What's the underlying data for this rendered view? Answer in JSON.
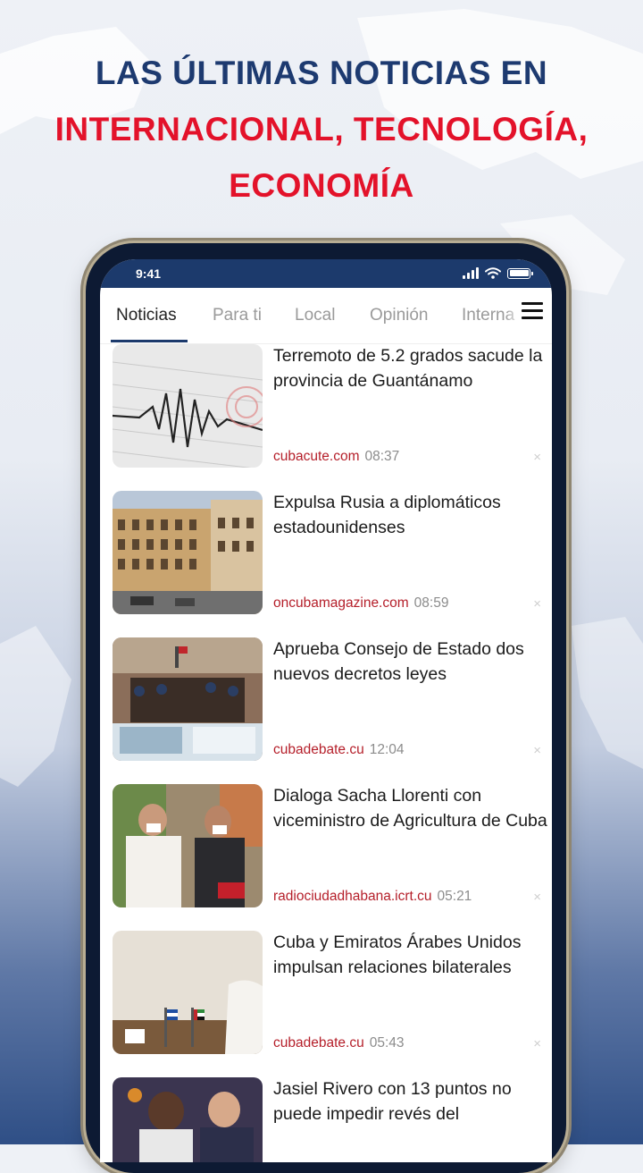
{
  "headline": {
    "line1": "LAS ÚLTIMAS NOTICIAS EN",
    "line2": "INTERNACIONAL, TECNOLOGÍA,",
    "line3": "ECONOMÍA"
  },
  "status_bar": {
    "time": "9:41",
    "icons": [
      "signal-icon",
      "wifi-icon",
      "battery-icon"
    ]
  },
  "tabs": [
    {
      "label": "Noticias",
      "active": true
    },
    {
      "label": "Para ti",
      "active": false
    },
    {
      "label": "Local",
      "active": false
    },
    {
      "label": "Opinión",
      "active": false
    },
    {
      "label": "Interna",
      "active": false
    }
  ],
  "menu_icon": "hamburger-menu-icon",
  "feed": [
    {
      "title": "Terremoto de 5.2 grados sacude la provincia de Guantánamo",
      "source": "cubacute.com",
      "time": "08:37",
      "thumb": "seismograph"
    },
    {
      "title": "Expulsa Rusia a diplomáticos estadounidenses",
      "source": "oncubamagazine.com",
      "time": "08:59",
      "thumb": "embassy-building"
    },
    {
      "title": "Aprueba Consejo de Estado dos nuevos decretos leyes",
      "source": "cubadebate.cu",
      "time": "12:04",
      "thumb": "council-meeting"
    },
    {
      "title": "Dialoga Sacha Llorenti con viceministro de Agricultura de Cuba",
      "source": "radiociudadhabana.icrt.cu",
      "time": "05:21",
      "thumb": "two-men-masks"
    },
    {
      "title": "Cuba y Emiratos Árabes Unidos impulsan relaciones bilaterales",
      "source": "cubadebate.cu",
      "time": "05:43",
      "thumb": "flags-table"
    },
    {
      "title": "Jasiel Rivero con 13 puntos no puede impedir revés del",
      "source": "",
      "time": "",
      "thumb": "basketball-players"
    }
  ],
  "close_glyph": "×",
  "colors": {
    "brand_blue": "#1c3a6c",
    "headline_red": "#e3122a",
    "headline_blue": "#1d3a70",
    "source_red": "#b51f2a"
  }
}
